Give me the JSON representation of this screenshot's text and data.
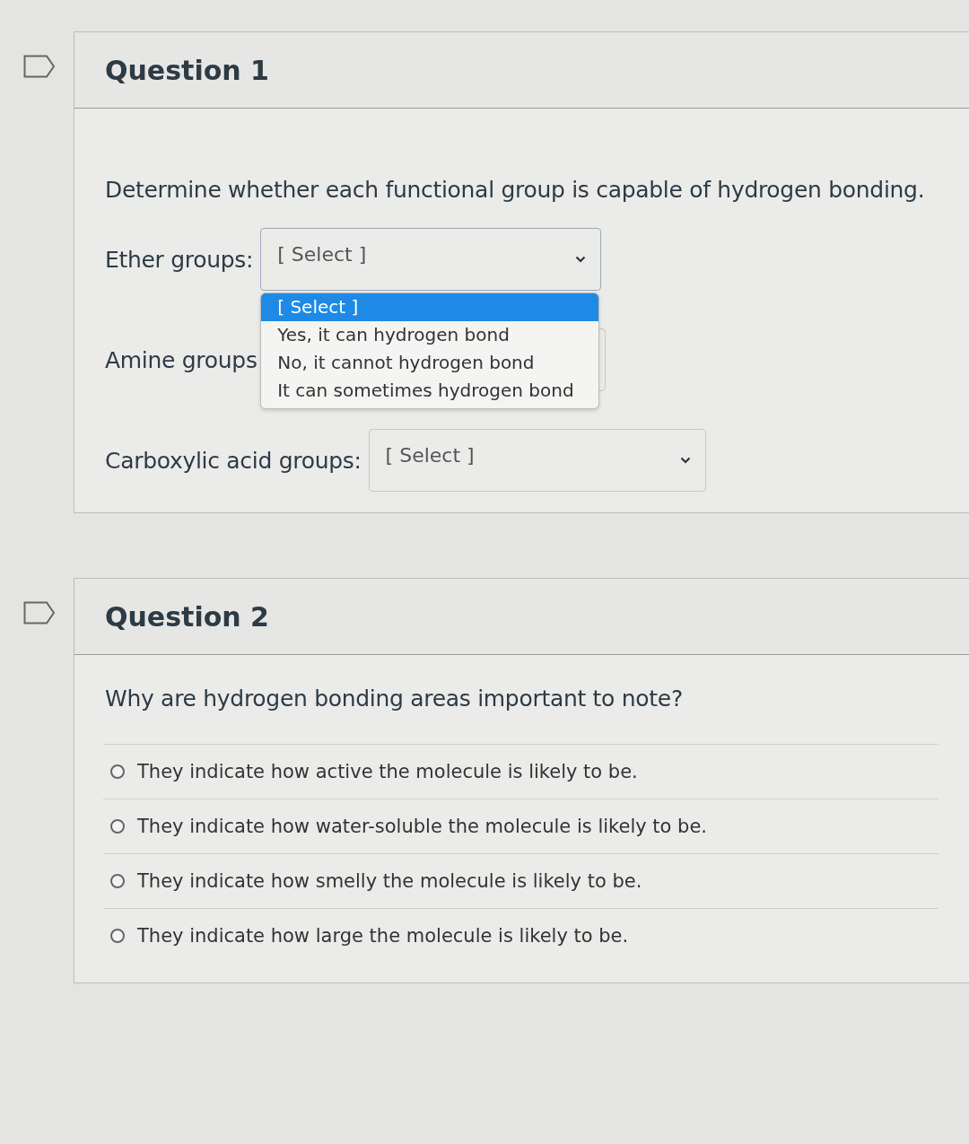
{
  "questions": [
    {
      "title": "Question 1",
      "kind": "dropdowns",
      "prompt": "Determine whether each functional group is capable of hydrogen bonding.",
      "items": [
        {
          "label": "Ether groups:",
          "value": "[ Select ]",
          "open": true,
          "options": [
            {
              "label": "[ Select ]",
              "selected": true
            },
            {
              "label": "Yes, it can hydrogen bond",
              "selected": false
            },
            {
              "label": "No, it cannot hydrogen bond",
              "selected": false
            },
            {
              "label": "It can sometimes hydrogen bond",
              "selected": false
            }
          ]
        },
        {
          "label": "Amine groups",
          "open": false
        },
        {
          "label": "Carboxylic acid groups:",
          "value": "[ Select ]",
          "open": false
        }
      ]
    },
    {
      "title": "Question 2",
      "kind": "multiple_choice",
      "prompt": "Why are hydrogen bonding areas important to note?",
      "answers": [
        {
          "text": "They indicate how active the molecule is likely to be.",
          "selected": false
        },
        {
          "text": "They indicate how water-soluble the molecule is likely to be.",
          "selected": false
        },
        {
          "text": "They indicate how smelly the molecule is likely to be.",
          "selected": false
        },
        {
          "text": "They indicate how large the molecule is likely to be.",
          "selected": false
        }
      ]
    }
  ]
}
